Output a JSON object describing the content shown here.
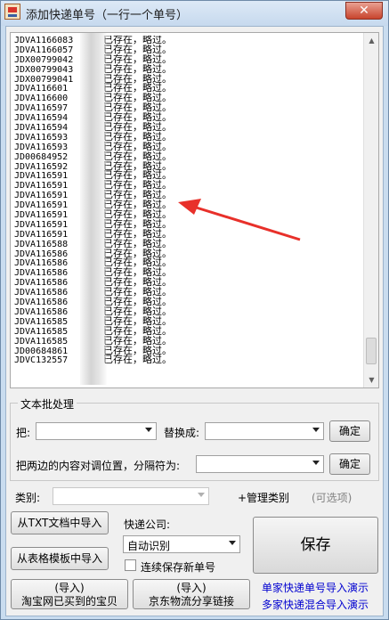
{
  "window": {
    "title": "添加快递单号（一行一个单号）",
    "close_label": "✕"
  },
  "log": {
    "lines": [
      {
        "code": "JDVA1166083",
        "status": "已存在，略过。"
      },
      {
        "code": "JDVA1166057",
        "status": "已存在，略过。"
      },
      {
        "code": "JDX00799042",
        "status": "已存在，略过。"
      },
      {
        "code": "JDX00799043",
        "status": "已存在，略过。"
      },
      {
        "code": "JDX00799041",
        "status": "已存在，略过。"
      },
      {
        "code": "JDVA116601",
        "status": "已存在，略过。"
      },
      {
        "code": "JDVA116600",
        "status": "已存在，略过。"
      },
      {
        "code": "JDVA116597",
        "status": "已存在，略过。"
      },
      {
        "code": "JDVA116594",
        "status": "已存在，略过。"
      },
      {
        "code": "JDVA116594",
        "status": "已存在，略过。"
      },
      {
        "code": "JDVA116593",
        "status": "已存在，略过。"
      },
      {
        "code": "JDVA116593",
        "status": "已存在，略过。"
      },
      {
        "code": "JD00684952",
        "status": "已存在，略过。"
      },
      {
        "code": "JDVA116592",
        "status": "已存在，略过。"
      },
      {
        "code": "JDVA116591",
        "status": "已存在，略过。"
      },
      {
        "code": "JDVA116591",
        "status": "已存在，略过。"
      },
      {
        "code": "JDVA116591",
        "status": "已存在，略过。"
      },
      {
        "code": "JDVA116591",
        "status": "已存在，略过。"
      },
      {
        "code": "JDVA116591",
        "status": "已存在，略过。"
      },
      {
        "code": "JDVA116591",
        "status": "已存在，略过。"
      },
      {
        "code": "JDVA116591",
        "status": "已存在，略过。"
      },
      {
        "code": "JDVA116588",
        "status": "已存在，略过。"
      },
      {
        "code": "JDVA116586",
        "status": "已存在，略过。"
      },
      {
        "code": "JDVA116586",
        "status": "已存在，略过。"
      },
      {
        "code": "JDVA116586",
        "status": "已存在，略过。"
      },
      {
        "code": "JDVA116586",
        "status": "已存在，略过。"
      },
      {
        "code": "JDVA116586",
        "status": "已存在，略过。"
      },
      {
        "code": "JDVA116586",
        "status": "已存在，略过。"
      },
      {
        "code": "JDVA116586",
        "status": "已存在，略过。"
      },
      {
        "code": "JDVA116585",
        "status": "已存在，略过。"
      },
      {
        "code": "JDVA116585",
        "status": "已存在，略过。"
      },
      {
        "code": "JDVA116585",
        "status": "已存在，略过。"
      },
      {
        "code": "JD00684861",
        "status": "已存在，略过。"
      },
      {
        "code": "JDVC132557",
        "status": "已存在，略过。"
      }
    ]
  },
  "batch": {
    "group_title": "文本批处理",
    "from_label": "把:",
    "replace_label": "替换成:",
    "confirm_label": "确定",
    "swap_label": "把两边的内容对调位置，分隔符为:",
    "confirm2_label": "确定"
  },
  "category": {
    "label": "类别:",
    "manage_label": "+管理类别",
    "optional_label": "(可选项)"
  },
  "import": {
    "txt_label": "从TXT文档中导入",
    "template_label": "从表格模板中导入",
    "taobao_line1": "(导入)",
    "taobao_line2": "淘宝网已买到的宝贝",
    "jd_line1": "(导入)",
    "jd_line2": "京东物流分享链接"
  },
  "courier": {
    "label": "快递公司:",
    "selected": "自动识别",
    "continuous_label": "连续保存新单号"
  },
  "save_label": "保存",
  "links": {
    "single_demo": "单家快递单号导入演示",
    "multi_demo": "多家快递混合导入演示"
  }
}
